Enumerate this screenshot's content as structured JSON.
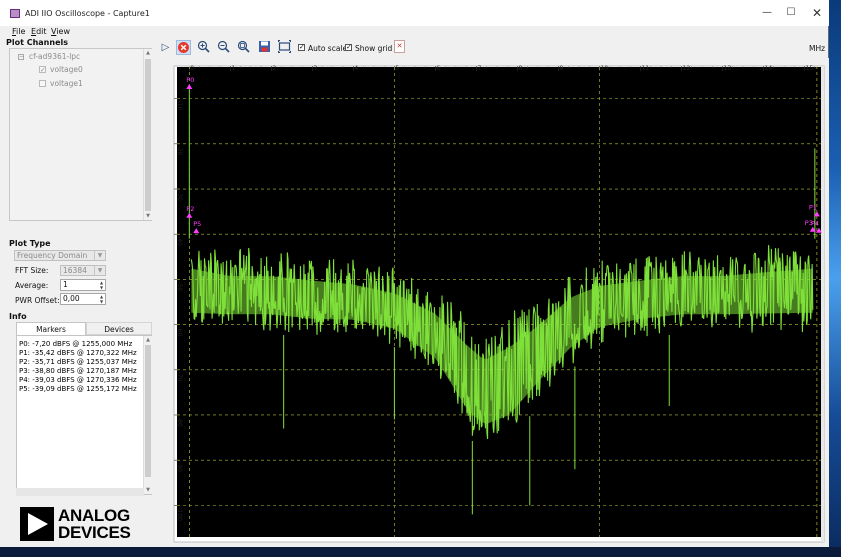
{
  "window": {
    "title": "ADI IIO Oscilloscope - Capture1",
    "controls": {
      "minimize": "—",
      "maximize": "☐",
      "close": "✕"
    }
  },
  "menu": [
    "File",
    "Edit",
    "View"
  ],
  "plot_channels": {
    "title": "Plot Channels",
    "device": "cf-ad9361-lpc",
    "channels": [
      {
        "label": "voltage0",
        "checked": true
      },
      {
        "label": "voltage1",
        "checked": false
      }
    ]
  },
  "plot_type": {
    "title": "Plot Type",
    "domain": "Frequency Domain",
    "fft_size_label": "FFT Size:",
    "fft_size": "16384",
    "average_label": "Average:",
    "average": "1",
    "pwr_offset_label": "PWR Offset:",
    "pwr_offset": "0,00"
  },
  "info": {
    "title": "Info",
    "tabs": [
      "Markers",
      "Devices"
    ],
    "markers": [
      "P0: -7,20 dBFS @ 1255,000 MHz",
      "P1: -35,42 dBFS @ 1270,322 MHz",
      "P2: -35,71 dBFS @ 1255,037 MHz",
      "P3: -38,80 dBFS @ 1270,187 MHz",
      "P4: -39,03 dBFS @ 1270,336 MHz",
      "P5: -39,09 dBFS @ 1255,172 MHz"
    ]
  },
  "logo": {
    "line1": "ANALOG",
    "line2": "DEVICES"
  },
  "toolbar": {
    "auto_scale_label": "Auto scale",
    "auto_scale_checked": true,
    "show_grid_label": "Show grid",
    "show_grid_checked": true,
    "unit": "MHz"
  },
  "chart_data": {
    "type": "line",
    "x_unit": "MHz",
    "xlim": [
      -0.3,
      15.4
    ],
    "ylim": [
      -107,
      -3
    ],
    "x_ticks": [
      "0",
      "1",
      "2",
      "3",
      "4",
      "5",
      "6",
      "7",
      "8",
      "9",
      "10",
      "11",
      "12",
      "13",
      "14",
      "15"
    ],
    "y_ticks": [
      -10,
      -20,
      -30,
      -40,
      -50,
      -60,
      -70,
      -80,
      -90,
      -100
    ],
    "grid": true,
    "series": [
      {
        "color": "#7fe03a",
        "envelope": [
          {
            "x": 0.05,
            "top": -41,
            "bottom": -62
          },
          {
            "x": 1,
            "top": -43,
            "bottom": -62
          },
          {
            "x": 2,
            "top": -43,
            "bottom": -62
          },
          {
            "x": 3,
            "top": -44,
            "bottom": -63
          },
          {
            "x": 4,
            "top": -45,
            "bottom": -63
          },
          {
            "x": 5,
            "top": -47,
            "bottom": -65
          },
          {
            "x": 6,
            "top": -51,
            "bottom": -72
          },
          {
            "x": 6.8,
            "top": -57,
            "bottom": -85
          },
          {
            "x": 7.2,
            "top": -60,
            "bottom": -88
          },
          {
            "x": 7.8,
            "top": -57,
            "bottom": -86
          },
          {
            "x": 8.5,
            "top": -53,
            "bottom": -78
          },
          {
            "x": 9.3,
            "top": -47,
            "bottom": -70
          },
          {
            "x": 10,
            "top": -45,
            "bottom": -65
          },
          {
            "x": 11,
            "top": -44,
            "bottom": -63
          },
          {
            "x": 12,
            "top": -43,
            "bottom": -62
          },
          {
            "x": 13,
            "top": -43,
            "bottom": -62
          },
          {
            "x": 14,
            "top": -42,
            "bottom": -62
          },
          {
            "x": 15.2,
            "top": -41,
            "bottom": -62
          }
        ],
        "spikes": [
          {
            "x": 0.0,
            "y": -7.2
          },
          {
            "x": 15.25,
            "y": -21
          },
          {
            "x": 2.3,
            "y": -83
          },
          {
            "x": 6.9,
            "y": -102
          },
          {
            "x": 8.3,
            "y": -100
          },
          {
            "x": 9.4,
            "y": -92
          },
          {
            "x": 5.0,
            "y": -81
          },
          {
            "x": 11.7,
            "y": -78
          }
        ]
      }
    ],
    "markers": [
      {
        "label": "P0",
        "x": 0.0,
        "y": -7.2
      },
      {
        "label": "P2",
        "x": 0.0,
        "y": -35.7
      },
      {
        "label": "P5",
        "x": 0.17,
        "y": -39.1
      },
      {
        "label": "P1",
        "x": 15.3,
        "y": -35.4
      },
      {
        "label": "P3",
        "x": 15.2,
        "y": -38.8
      },
      {
        "label": "P4",
        "x": 15.35,
        "y": -39.0
      }
    ],
    "cursor_lines": [
      0.0,
      15.3
    ]
  }
}
